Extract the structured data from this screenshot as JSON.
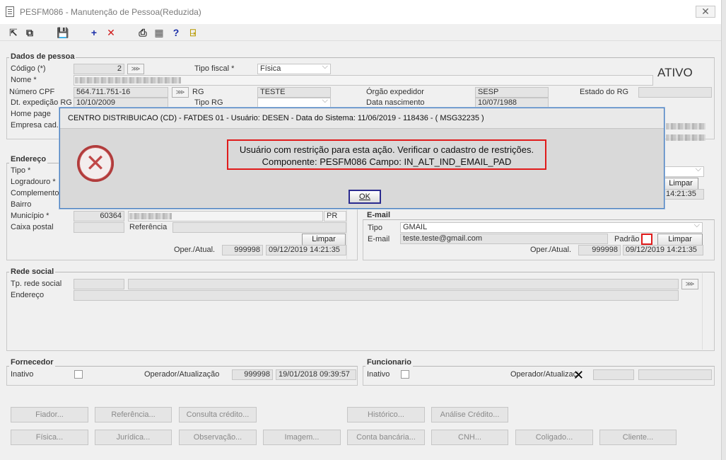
{
  "window": {
    "title": "PESFM086 - Manutenção de Pessoa(Reduzida)",
    "close": "✕"
  },
  "toolbar": [
    {
      "name": "navigate-icon",
      "glyph": "⇱",
      "color": "#333"
    },
    {
      "name": "copy-icon",
      "glyph": "⧉",
      "color": "#333"
    },
    {
      "name": "save-icon",
      "glyph": "💾",
      "color": "#333"
    },
    {
      "name": "add-icon",
      "glyph": "+",
      "color": "#1a2ea8"
    },
    {
      "name": "delete-icon",
      "glyph": "✕",
      "color": "#d01818"
    },
    {
      "name": "print-icon",
      "glyph": "⎙",
      "color": "#333"
    },
    {
      "name": "table-icon",
      "glyph": "▦",
      "color": "#555"
    },
    {
      "name": "help-icon",
      "glyph": "?",
      "color": "#1a2ea8"
    },
    {
      "name": "exit-icon",
      "glyph": "⍈",
      "color": "#b89a00"
    }
  ],
  "status": "ATIVO",
  "dados": {
    "title": "Dados de pessoa",
    "codigo_label": "Código (*)",
    "codigo": "2",
    "tipo_fiscal_label": "Tipo fiscal *",
    "tipo_fiscal": "Física",
    "nome_label": "Nome *",
    "cpf_label": "Número CPF",
    "cpf": "564.711.751-16",
    "rg_label": "RG",
    "rg": "TESTE",
    "orgao_label": "Órgão expedidor",
    "orgao": "SESP",
    "estado_rg_label": "Estado do RG",
    "dt_exp_label": "Dt. expedição RG",
    "dt_exp": "10/10/2009",
    "tipo_rg_label": "Tipo RG",
    "data_nasc_label": "Data nascimento",
    "data_nasc": "10/07/1988",
    "home_label": "Home page",
    "empresa_label": "Empresa cad."
  },
  "endereco": {
    "title": "Endereço",
    "tipo_label": "Tipo *",
    "logradouro_label": "Logradouro *",
    "complemento_label": "Complemento",
    "bairro_label": "Bairro",
    "municipio_label": "Município *",
    "municipio": "60364",
    "uf": "PR",
    "caixa_label": "Caixa postal",
    "referencia_label": "Referência",
    "limpar": "Limpar",
    "oper_label": "Oper./Atual.",
    "oper": "999998",
    "oper_date": "09/12/2019 14:21:35"
  },
  "telefone": {
    "limpar": "Limpar",
    "date": "14:21:35"
  },
  "email": {
    "title": "E-mail",
    "tipo_label": "Tipo",
    "tipo": "GMAIL",
    "email_label": "E-mail",
    "email": "teste.teste@gmail.com",
    "padrao_label": "Padrão",
    "limpar": "Limpar",
    "oper_label": "Oper./Atual.",
    "oper": "999998",
    "oper_date": "09/12/2019 14:21:35"
  },
  "rede": {
    "title": "Rede social",
    "tp_label": "Tp. rede social",
    "end_label": "Endereço"
  },
  "fornecedor": {
    "title": "Fornecedor",
    "inativo_label": "Inativo",
    "oper_label": "Operador/Atualização",
    "oper": "999998",
    "oper_date": "19/01/2018 09:39:57"
  },
  "funcionario": {
    "title": "Funcionario",
    "inativo_label": "Inativo",
    "oper_label": "Operador/Atualização"
  },
  "buttons_row1": [
    "Fiador...",
    "Referência...",
    "Consulta crédito...",
    "Histórico...",
    "Análise Crédito..."
  ],
  "buttons_row2": [
    "Física...",
    "Jurídica...",
    "Observação...",
    "Imagem...",
    "Conta bancária...",
    "CNH...",
    "Coligado...",
    "Cliente..."
  ],
  "dialog": {
    "title": "CENTRO DISTRIBUICAO (CD) - FATDES 01 - Usuário: DESEN - Data do Sistema: 11/06/2019 - 118436 - ( MSG32235 )",
    "line1": "Usuário com restrição para esta ação. Verificar o cadastro de restrições.",
    "line2": "Componente: PESFM086 Campo: IN_ALT_IND_EMAIL_PAD",
    "ok": "OK"
  }
}
